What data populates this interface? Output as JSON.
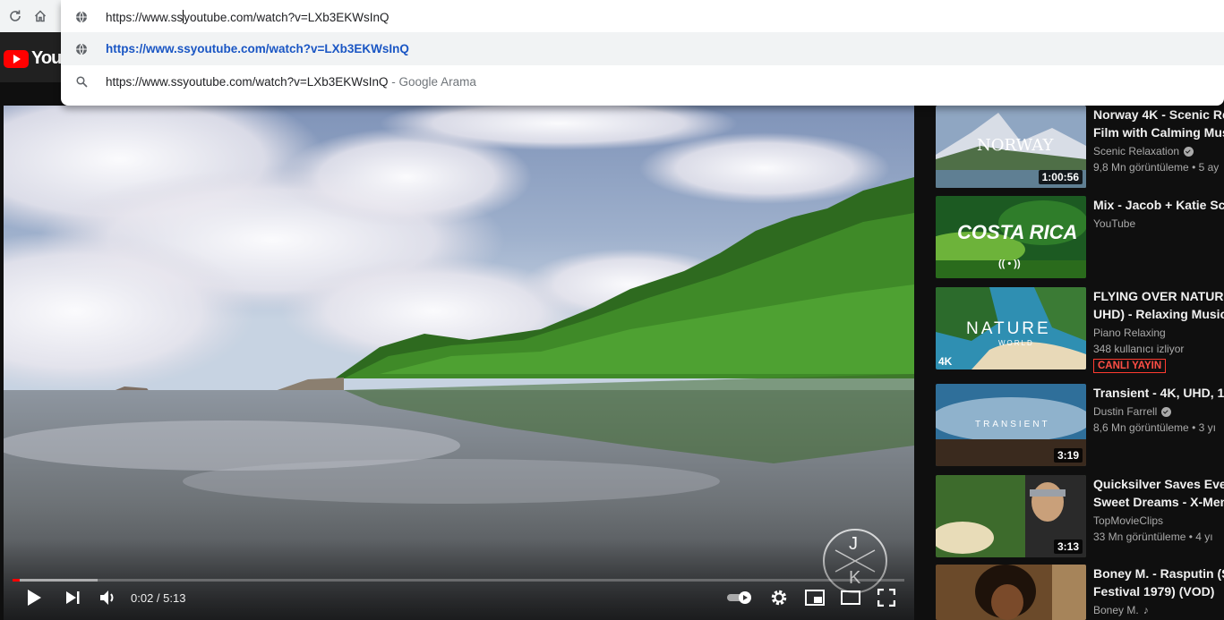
{
  "omnibox": {
    "input_before_caret": "https://www.ss",
    "input_after_caret": "youtube.com/watch?v=LXb3EKWsInQ",
    "suggestion_url": "https://www.ssyoutube.com/watch?v=LXb3EKWsInQ",
    "search_query": "https://www.ssyoutube.com/watch?v=LXb3EKWsInQ",
    "search_hint": " - Google Arama"
  },
  "header": {
    "logo_text": "YouTube"
  },
  "player": {
    "time_current": "0:02",
    "time_separator": " / ",
    "time_total": "5:13",
    "progress_played_fraction": 0.005,
    "progress_buffered_fraction": 0.095,
    "watermark_letters": [
      "J",
      "K"
    ]
  },
  "sidebar": [
    {
      "title1": "Norway 4K - Scenic Re",
      "title2": "Film with Calming Mus",
      "channel": "Scenic Relaxation",
      "verified": true,
      "views": "9,8 Mn görüntüleme • 5 ay",
      "duration": "1:00:56",
      "thumb_text": "NORWAY"
    },
    {
      "title1": "Mix - Jacob + Katie Sc",
      "title2": "",
      "channel": "YouTube",
      "verified": false,
      "views": "",
      "duration": "",
      "thumb_text": "COSTA RICA",
      "thumb_icon": "(( • ))"
    },
    {
      "title1": "FLYING OVER NATURE",
      "title2": "UHD) - Relaxing Music",
      "channel": "Piano Relaxing",
      "verified": false,
      "views": "348 kullanıcı izliyor",
      "live_badge": "CANLI YAYIN",
      "duration": "",
      "thumb_text": "NATURE",
      "thumb_sub": "WORLD",
      "thumb_corner": "4K"
    },
    {
      "title1": "Transient - 4K, UHD, 10",
      "title2": "",
      "channel": "Dustin Farrell",
      "verified": true,
      "views": "8,6 Mn görüntüleme • 3 yı",
      "duration": "3:19",
      "thumb_text": "TRANSIENT"
    },
    {
      "title1": "Quicksilver Saves Ever",
      "title2": "Sweet Dreams - X-Men",
      "channel": "TopMovieClips",
      "verified": false,
      "views": "33 Mn görüntüleme • 4 yı",
      "duration": "3:13"
    },
    {
      "title1": "Boney M. - Rasputin (S",
      "title2": "Festival 1979) (VOD)",
      "channel": "Boney M.",
      "verified": false,
      "music_note": "♪",
      "views": "",
      "duration": ""
    }
  ]
}
